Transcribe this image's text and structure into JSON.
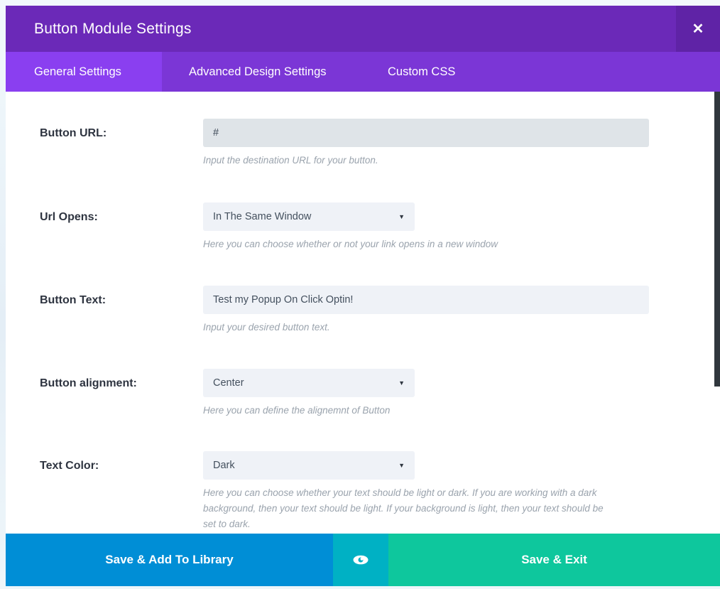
{
  "window": {
    "title": "Button Module Settings",
    "close_icon": "close-icon",
    "close_label": "✕"
  },
  "tabs": [
    {
      "label": "General Settings",
      "active": true
    },
    {
      "label": "Advanced Design Settings",
      "active": false
    },
    {
      "label": "Custom CSS",
      "active": false
    }
  ],
  "fields": [
    {
      "label": "Button URL:",
      "type": "text",
      "value": "#",
      "placeholder": "",
      "description": "Input the destination URL for your button."
    },
    {
      "label": "Url Opens:",
      "type": "select",
      "value": "In The Same Window",
      "description": "Here you can choose whether or not your link opens in a new window"
    },
    {
      "label": "Button Text:",
      "type": "text",
      "value": "Test my Popup On Click Optin!",
      "placeholder": "",
      "description": "Input your desired button text."
    },
    {
      "label": "Button alignment:",
      "type": "select",
      "value": "Center",
      "description": "Here you can define the alignemnt of Button"
    },
    {
      "label": "Text Color:",
      "type": "select",
      "value": "Dark",
      "description": "Here you can choose whether your text should be light or dark. If you are working with a dark background, then your text should be light. If your background is light, then your text should be set to dark."
    }
  ],
  "footer": {
    "save_library_label": "Save & Add To Library",
    "preview_icon": "eye-icon",
    "save_exit_label": "Save & Exit"
  },
  "colors": {
    "titlebar": "#6b29b8",
    "close_bg": "#5f23a6",
    "tabbar": "#7b36d6",
    "tab_active": "#8a3ff0",
    "save_library": "#008ed6",
    "preview": "#00b1c4",
    "save_exit": "#0ec79d",
    "scrollbar_thumb": "#30373d"
  }
}
